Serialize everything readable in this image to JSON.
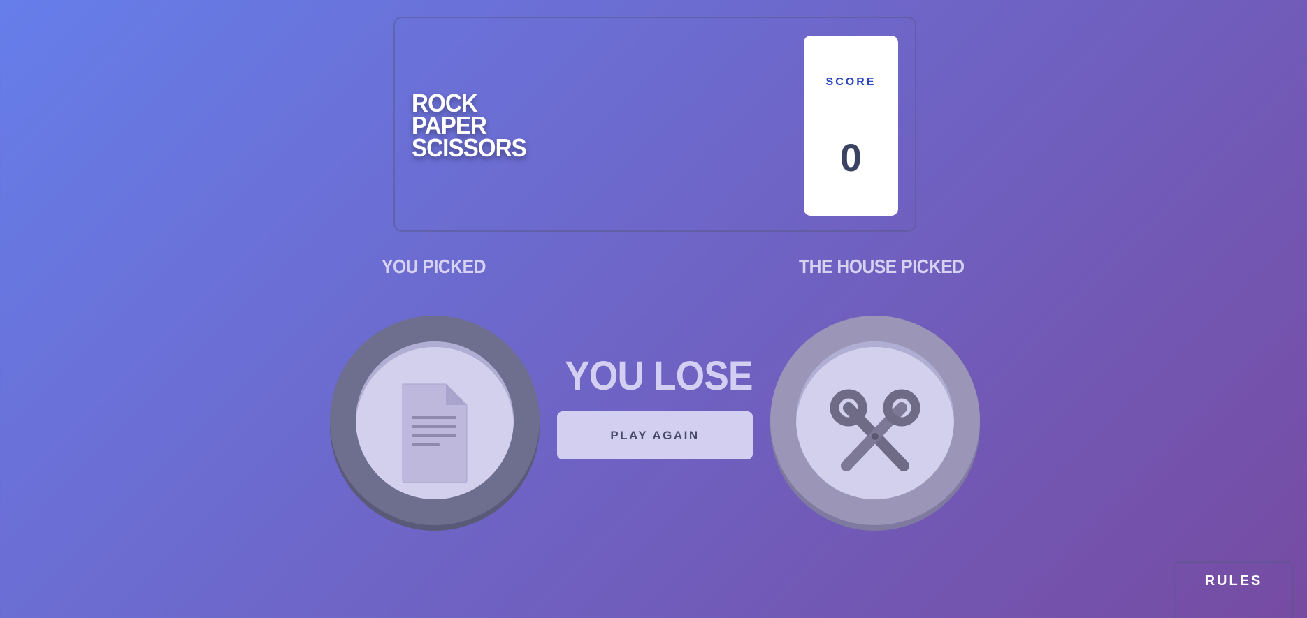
{
  "header": {
    "title_lines": [
      "ROCK",
      "PAPER",
      "SCISSORS"
    ],
    "score_label": "SCORE",
    "score_value": "0"
  },
  "player": {
    "label": "YOU PICKED",
    "choice": "paper",
    "icon": "paper-icon"
  },
  "house": {
    "label": "THE HOUSE PICKED",
    "choice": "scissors",
    "icon": "scissors-icon"
  },
  "result": {
    "text": "YOU LOSE",
    "play_again_label": "PLAY AGAIN"
  },
  "rules_label": "RULES",
  "colors": {
    "background_start": "#667eea",
    "background_end": "#764ba2",
    "score_label": "#2a46c0",
    "score_value": "#3b4363",
    "token_inner": "#d3d0ee",
    "player_ring": "#6e6e8e",
    "house_ring": "#9b96b8"
  }
}
